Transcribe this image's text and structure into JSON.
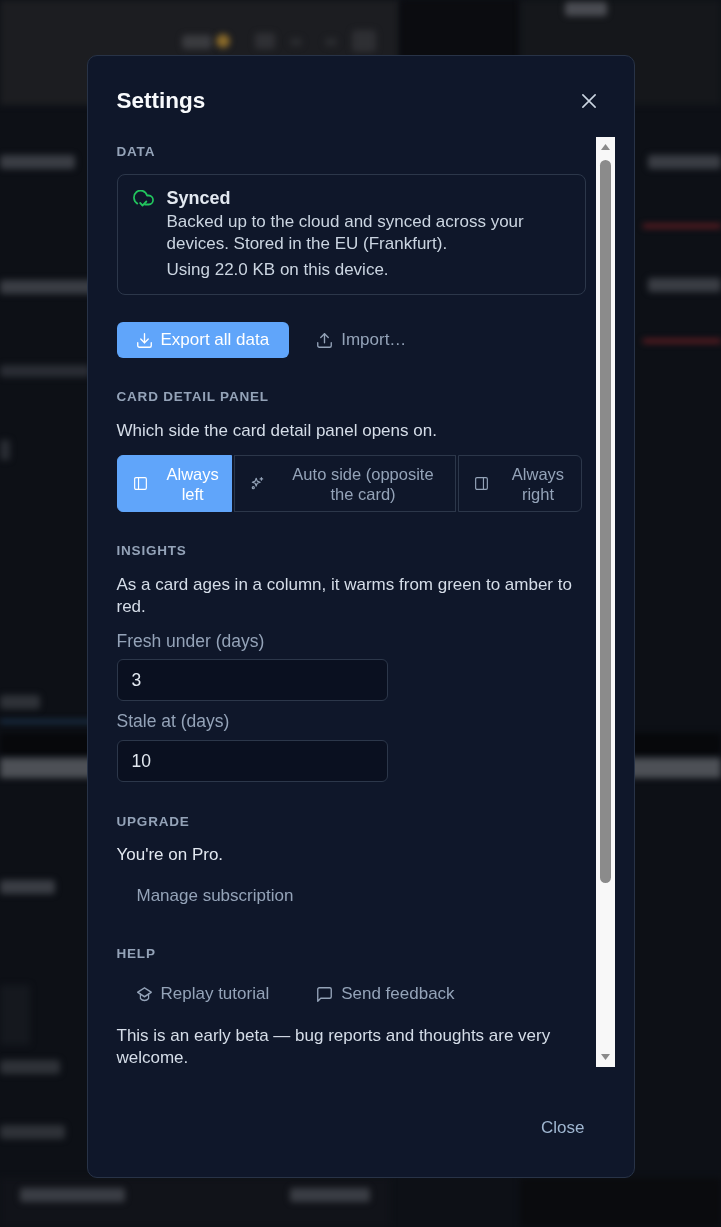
{
  "dialog": {
    "title": "Settings"
  },
  "sections": [
    {
      "kind": "data",
      "heading": "DATA",
      "status": {
        "title": "Synced",
        "description": "Backed up to the cloud and synced across your devices. Stored in the EU (Frankfurt).",
        "usage": "Using 22.0 KB on this device."
      },
      "actions": [
        {
          "label": "Export all data",
          "kind": "primary"
        },
        {
          "label": "Import…",
          "kind": "ghost"
        }
      ]
    },
    {
      "kind": "choice",
      "heading": "CARD DETAIL PANEL",
      "description": "Which side the card detail panel opens on.",
      "options": [
        {
          "label": "Always left",
          "selected": true
        },
        {
          "label": "Auto side (opposite the card)",
          "selected": false
        },
        {
          "label": "Always right",
          "selected": false
        }
      ]
    },
    {
      "kind": "fields",
      "heading": "INSIGHTS",
      "description": "As a card ages in a column, it warms from green to amber to red.",
      "fields": [
        {
          "label": "Fresh under (days)",
          "value": "3"
        },
        {
          "label": "Stale at (days)",
          "value": "10"
        }
      ]
    },
    {
      "kind": "upgrade",
      "heading": "UPGRADE",
      "description": "You're on Pro.",
      "actions": [
        {
          "label": "Manage subscription",
          "kind": "ghost"
        }
      ]
    },
    {
      "kind": "help",
      "heading": "HELP",
      "actions": [
        {
          "label": "Replay tutorial",
          "kind": "ghost"
        },
        {
          "label": "Send feedback",
          "kind": "ghost"
        }
      ],
      "note": "This is an early beta — bug reports and thoughts are very welcome."
    }
  ],
  "footer": {
    "close_button": "Close"
  }
}
